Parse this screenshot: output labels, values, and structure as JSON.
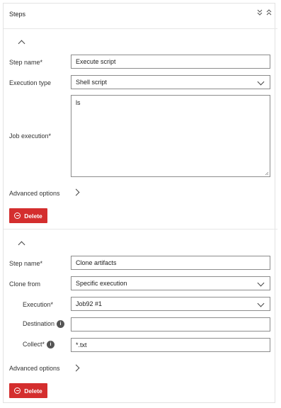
{
  "panel": {
    "title": "Steps",
    "collapse_all_icon": "double-chevron-down-icon",
    "expand_all_icon": "double-chevron-up-icon"
  },
  "step1": {
    "step_name_label": "Step name*",
    "step_name_value": "Execute script",
    "execution_type_label": "Execution type",
    "execution_type_value": "Shell script",
    "job_execution_label": "Job execution*",
    "job_execution_value": "ls",
    "advanced_options_label": "Advanced options",
    "delete_label": "Delete"
  },
  "step2": {
    "step_name_label": "Step name*",
    "step_name_value": "Clone artifacts",
    "clone_from_label": "Clone from",
    "clone_from_value": "Specific execution",
    "execution_label": "Execution*",
    "execution_value": "Job92 #1",
    "destination_label": "Destination",
    "destination_value": "",
    "collect_label": "Collect*",
    "collect_value": "*.txt",
    "advanced_options_label": "Advanced options",
    "delete_label": "Delete"
  },
  "colors": {
    "delete_red": "#d42e2e",
    "border": "#8c8c8c",
    "info_badge": "#555555"
  }
}
